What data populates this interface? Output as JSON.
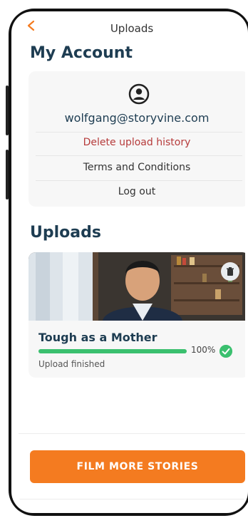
{
  "header": {
    "title": "Uploads",
    "back_icon": "chevron-left-icon",
    "accent": "#f47b20"
  },
  "account": {
    "heading": "My Account",
    "avatar_icon": "user-circle-icon",
    "email": "wolfgang@storyvine.com",
    "delete_history": "Delete upload history",
    "terms": "Terms and Conditions",
    "logout": "Log out"
  },
  "uploads": {
    "heading": "Uploads",
    "items": [
      {
        "title": "Tough as a Mother",
        "progress_percent": 100,
        "progress_label": "100%",
        "status": "Upload finished",
        "delete_icon": "trash-icon",
        "status_icon": "check-circle-icon"
      }
    ]
  },
  "cta": {
    "label": "FILM MORE STORIES",
    "color": "#f47b20"
  },
  "colors": {
    "heading": "#1e3d52",
    "success": "#3bc06f",
    "danger": "#b63b3b"
  }
}
